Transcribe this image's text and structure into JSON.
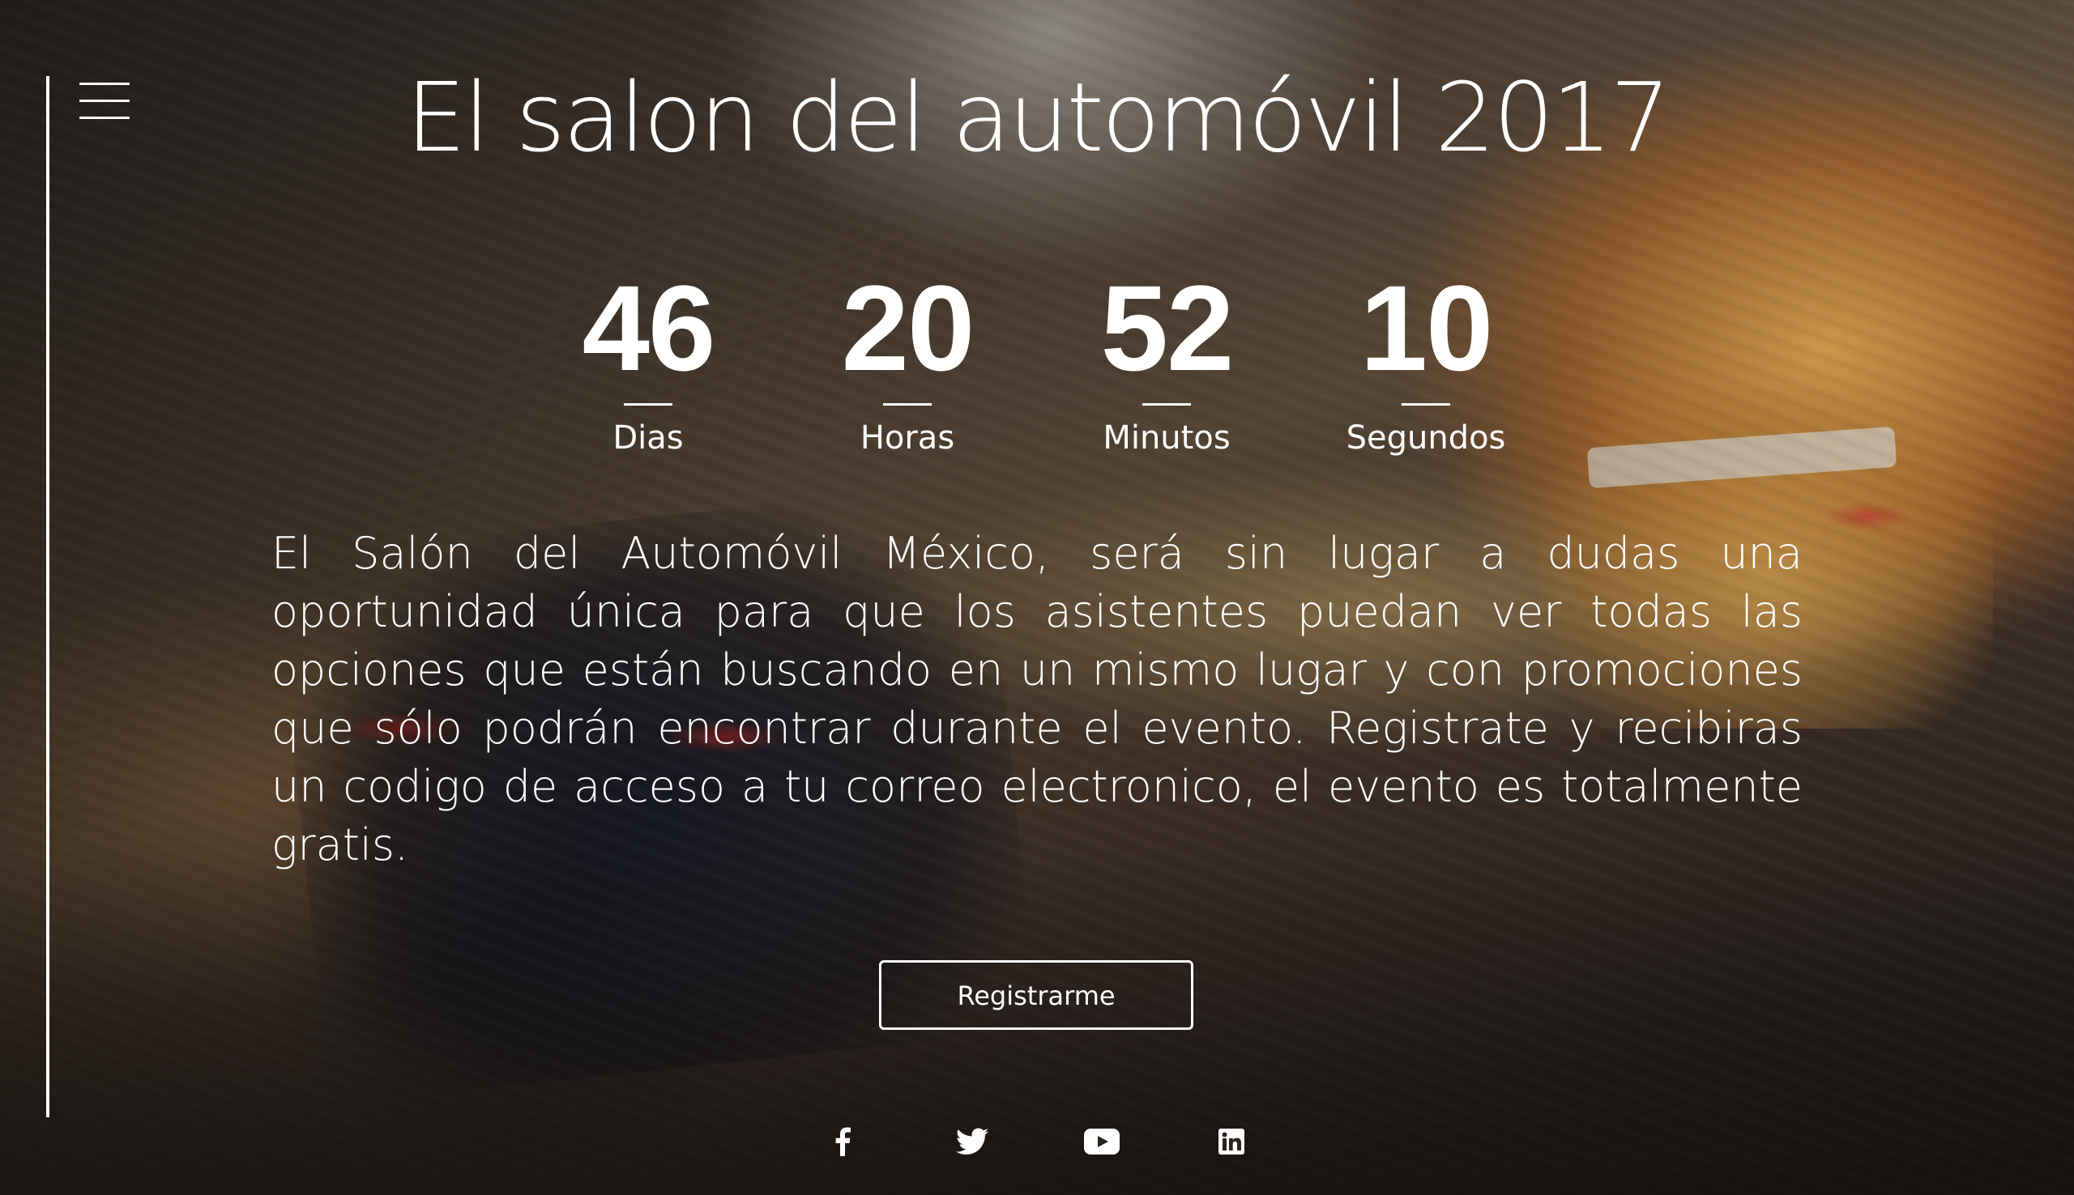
{
  "header": {
    "title": "El salon del automóvil 2017"
  },
  "countdown": [
    {
      "value": "46",
      "label": "Dias"
    },
    {
      "value": "20",
      "label": "Horas"
    },
    {
      "value": "52",
      "label": "Minutos"
    },
    {
      "value": "10",
      "label": "Segundos"
    }
  ],
  "description": "El Salón del Automóvil México, será sin lugar a dudas una oportunidad única para que los asistentes puedan ver todas las opciones que están buscando en un mismo lugar y con promociones que sólo podrán encontrar durante el evento. Registrate y recibiras un codigo de acceso a tu correo electronico, el evento es totalmente gratis.",
  "cta": {
    "register_label": "Registrarme"
  },
  "social": [
    {
      "icon": "facebook-icon"
    },
    {
      "icon": "twitter-icon"
    },
    {
      "icon": "youtube-icon"
    },
    {
      "icon": "linkedin-icon"
    }
  ],
  "menu": {
    "icon": "hamburger-menu-icon"
  },
  "colors": {
    "text": "#ffffff",
    "accent": "#ffffff"
  }
}
